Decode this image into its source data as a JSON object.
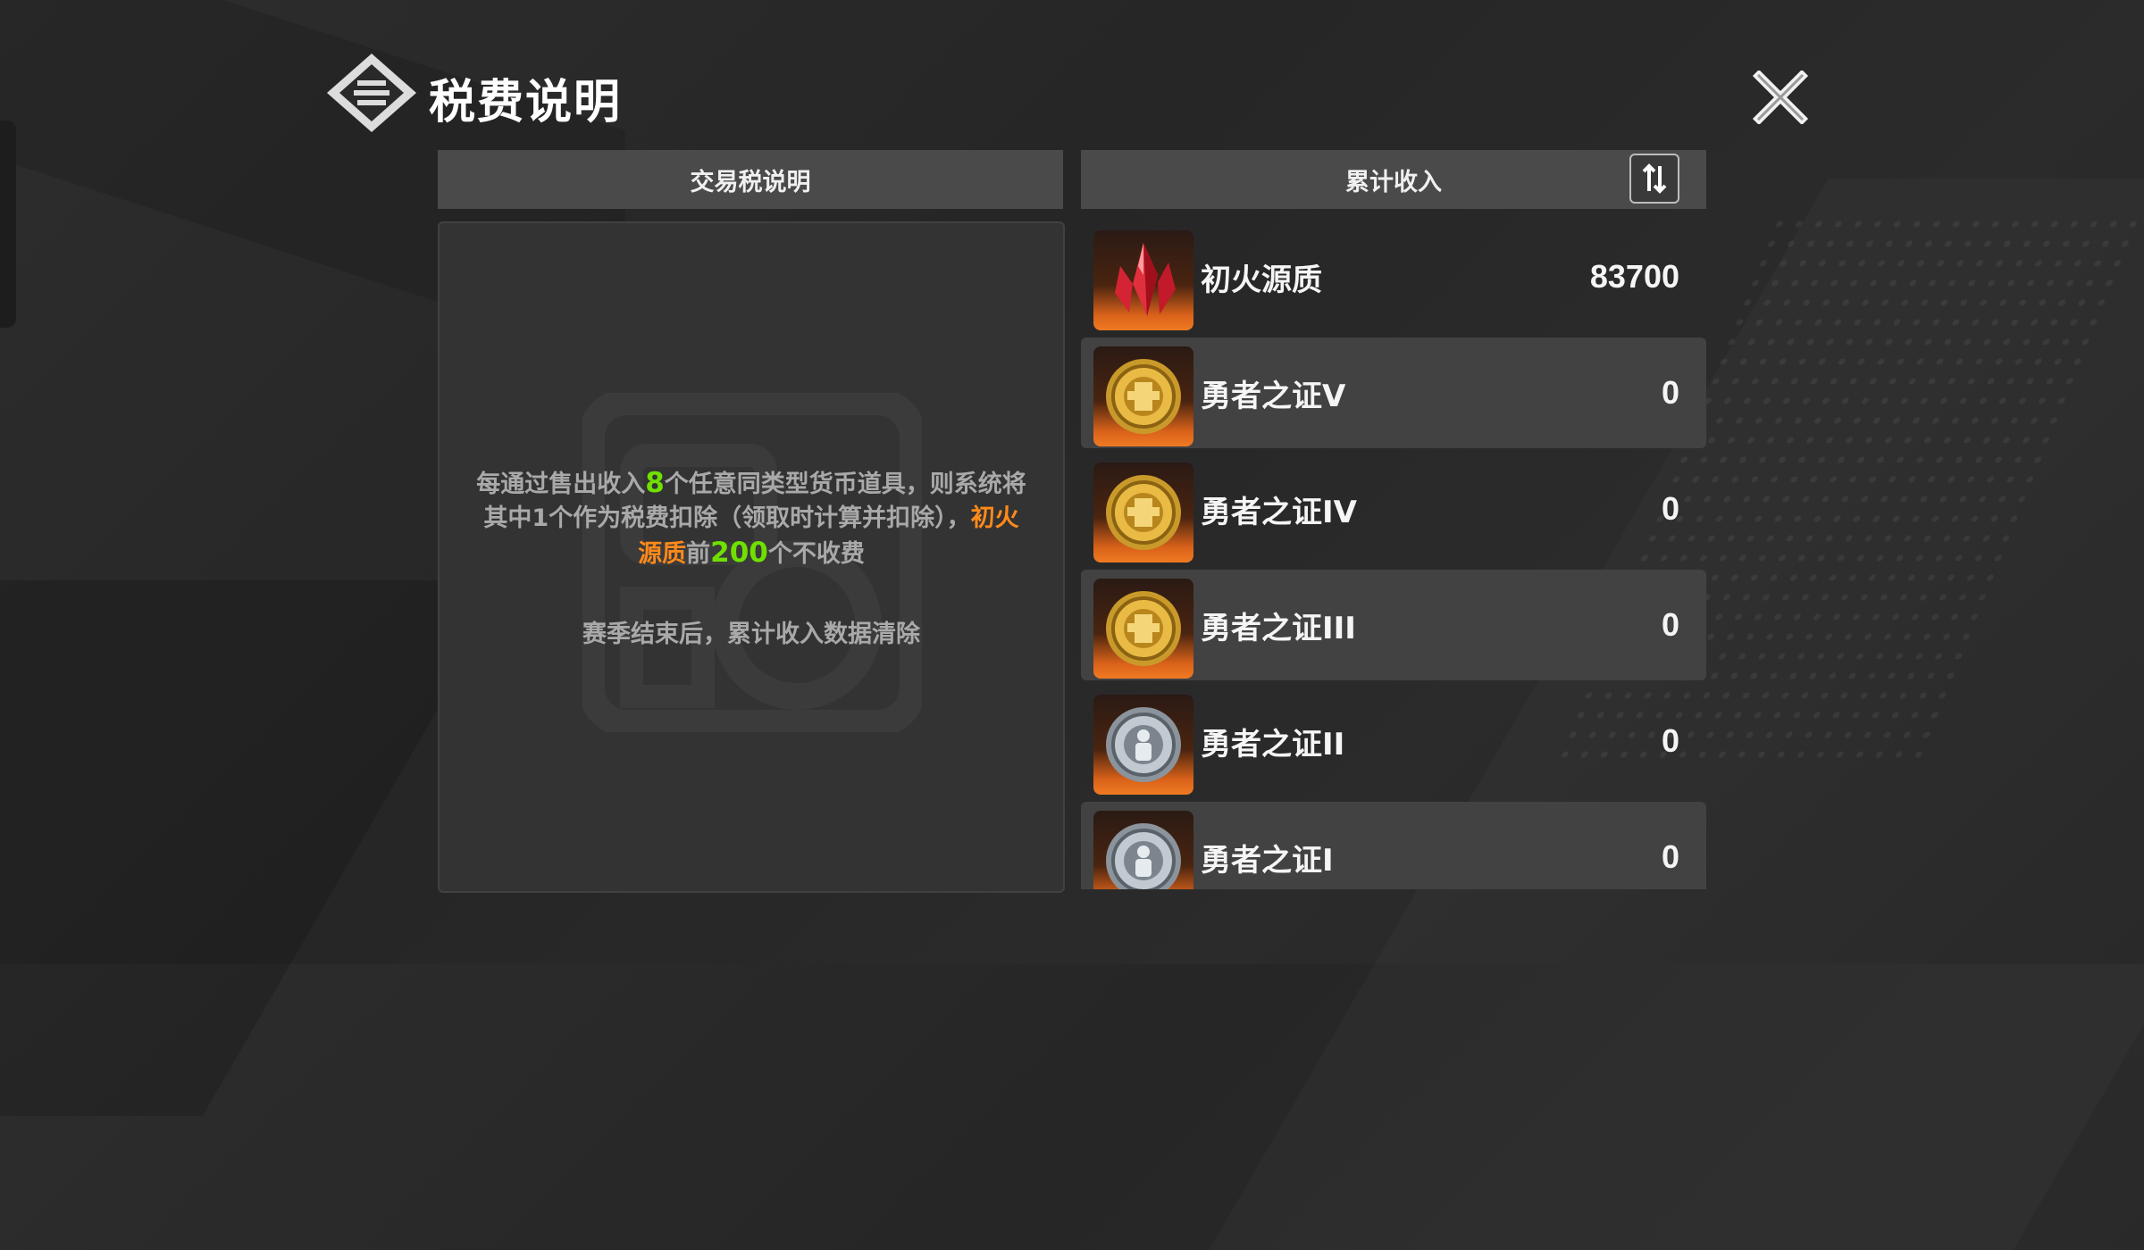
{
  "title": "税费说明",
  "icons": {
    "header": "menu-diamond-icon",
    "close": "close-icon",
    "sort": "sort-icon"
  },
  "left_panel": {
    "header": "交易税说明",
    "desc_part1": "每通过售出收入",
    "desc_num1": "8",
    "desc_part2": "个任意同类型货币道具，则系统将其中1个作为税费扣除（领取时计算并扣除），",
    "desc_item": "初火源质",
    "desc_part3": "前",
    "desc_num2": "200",
    "desc_part4": "个不收费",
    "note": "赛季结束后，累计收入数据清除"
  },
  "right_panel": {
    "header": "累计收入",
    "items": [
      {
        "name": "初火源质",
        "value": "83700",
        "icon": "red-crystal-icon"
      },
      {
        "name": "勇者之证V",
        "value": "0",
        "icon": "gold-medal-icon"
      },
      {
        "name": "勇者之证IV",
        "value": "0",
        "icon": "gold-medal-icon"
      },
      {
        "name": "勇者之证III",
        "value": "0",
        "icon": "gold-medal-icon"
      },
      {
        "name": "勇者之证II",
        "value": "0",
        "icon": "silver-medal-icon"
      },
      {
        "name": "勇者之证I",
        "value": "0",
        "icon": "silver-medal-icon"
      }
    ]
  },
  "colors": {
    "green_highlight": "#6fe000",
    "orange_highlight": "#ff8a1a",
    "panel_header": "#4a4a4a"
  }
}
